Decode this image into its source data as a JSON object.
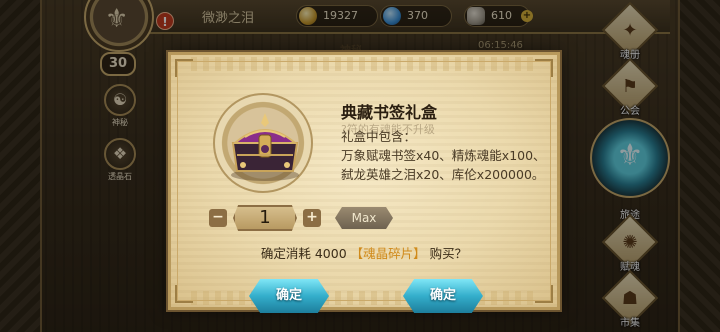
{
  "topbar": {
    "player_name": "微渺之泪",
    "resources": [
      {
        "icon": "gold-coin-icon",
        "value": "19327"
      },
      {
        "icon": "blue-gem-icon",
        "value": "370"
      },
      {
        "icon": "stone-icon",
        "value": "610"
      }
    ],
    "add_symbol": "+",
    "behind_tab": "神秘",
    "timer": "06:15:46"
  },
  "avatar": {
    "level": "30",
    "alert": "!"
  },
  "left_menu": [
    {
      "label": "神秘",
      "icon": "mystery-icon"
    },
    {
      "label": "透晶石",
      "icon": "crystal-icon"
    }
  ],
  "right_menu": [
    {
      "label": "魂册",
      "icon": "soul-book-icon"
    },
    {
      "label": "公会",
      "icon": "guild-icon"
    },
    {
      "label": "旅途",
      "icon": "journey-icon"
    },
    {
      "label": "赋魂",
      "icon": "soul-infuse-icon"
    },
    {
      "label": "市集",
      "icon": "market-icon"
    }
  ],
  "dialog": {
    "title": "典藏书签礼盒",
    "faded_line": "?符的有魂能不升级",
    "desc": "礼盒中包含：\n万象赋魂书签x40、精炼魂能x100、弑龙英雄之泪x20、库伦x200000。",
    "quantity": "1",
    "minus": "−",
    "plus": "+",
    "max_label": "Max",
    "confirm_prefix": "确定消耗 4000 ",
    "confirm_item": "【魂晶碎片】",
    "confirm_suffix": " 购买？",
    "buttons": [
      "确定",
      "确定"
    ]
  },
  "colors": {
    "accent_cyan": "#34aecb",
    "highlight_orange": "#d08a1a",
    "parchment": "#ebd9ac"
  }
}
